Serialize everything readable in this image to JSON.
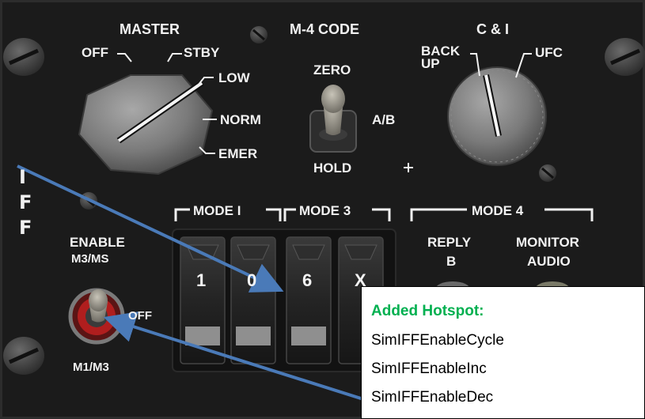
{
  "panel": {
    "master": {
      "title": "MASTER",
      "positions": {
        "off": "OFF",
        "stby": "STBY",
        "low": "LOW",
        "norm": "NORM",
        "emer": "EMER"
      }
    },
    "m4_code": {
      "title": "M-4 CODE",
      "positions": {
        "zero": "ZERO",
        "ab": "A/B",
        "hold": "HOLD"
      }
    },
    "c_and_i": {
      "title": "C & I",
      "positions": {
        "back": "BACK",
        "up": "UP",
        "ufc": "UFC"
      }
    },
    "iff_letters": [
      "I",
      "F",
      "F"
    ],
    "enable": {
      "title": "ENABLE",
      "top": "M3/MS",
      "off": "OFF",
      "bottom": "M1/M3"
    },
    "mode1_label": "MODE I",
    "mode3_label": "MODE 3",
    "mode4_label": "MODE 4",
    "mode4_reply": {
      "line1": "REPLY",
      "line2": "B"
    },
    "mode4_monitor": {
      "line1": "MONITOR",
      "line2": "AUDIO"
    },
    "wheels": [
      "1",
      "0",
      "6",
      "X"
    ],
    "plus": "+"
  },
  "callout": {
    "heading": "Added Hotspot:",
    "items": [
      "SimIFFEnableCycle",
      "SimIFFEnableInc",
      "SimIFFEnableDec"
    ]
  },
  "colors": {
    "panel": "#1a1a1a",
    "label": "#f2f2f2",
    "heading": "#00b050",
    "arrow": "#4a7ab8"
  }
}
